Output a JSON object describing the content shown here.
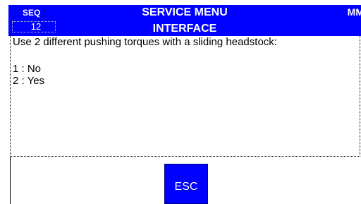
{
  "header": {
    "seq_label": "SEQ",
    "seq_value": "12",
    "title": "SERVICE MENU",
    "subtitle": "INTERFACE",
    "mode": "MM"
  },
  "content": {
    "question": "Use 2 different pushing torques with a sliding headstock:",
    "options": [
      {
        "label": "1 : No"
      },
      {
        "label": "2 : Yes"
      }
    ]
  },
  "footer": {
    "esc_label": "ESC"
  },
  "colors": {
    "header_bg": "#0000ff",
    "button_bg": "#0000ff",
    "text_on_blue": "#ffffff",
    "background": "#ffffff"
  }
}
